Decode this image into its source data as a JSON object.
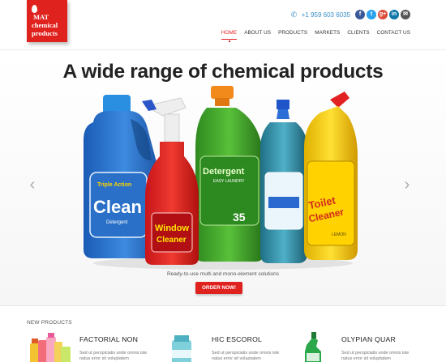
{
  "logo": {
    "line1": "MAT",
    "line2": "chemical",
    "line3": "products"
  },
  "header": {
    "phone": "+1 959 603 6035"
  },
  "nav": {
    "items": [
      {
        "label": "HOME"
      },
      {
        "label": "ABOUT US"
      },
      {
        "label": "PRODUCTS"
      },
      {
        "label": "MARKETS"
      },
      {
        "label": "CLIENTS"
      },
      {
        "label": "CONTACT US"
      }
    ]
  },
  "social": {
    "fb": "f",
    "tw": "t",
    "gp": "g+",
    "in": "in",
    "mail": "✉"
  },
  "hero": {
    "title": "A wide range of chemical products",
    "caption": "Ready-to-use multi and mono-element solutions",
    "button": "ORDER NOW!",
    "bottle_labels": {
      "triple": "Triple Action",
      "clean": "Clean",
      "detergent": "Detergent",
      "window1": "Window",
      "window2": "Cleaner",
      "green": "Detergent",
      "green_sub": "EASY LAUNDRY",
      "green_num": "35",
      "toilet1": "Toilet",
      "toilet2": "Cleaner",
      "lemon": "LEMON"
    }
  },
  "products": {
    "section_title": "NEW PRODUCTS",
    "items": [
      {
        "name": "FACTORIAL NON",
        "desc": "Sed ut perspiciatis unde omnis iste natus error sit voluptatem"
      },
      {
        "name": "HIC ESCOROL",
        "desc": "Sed ut perspiciatis unde omnis iste natus error sit voluptatem"
      },
      {
        "name": "OLYPIAN QUAR",
        "desc": "Sed ut perspiciatis unde omnis iste natus error sit voluptatem"
      }
    ]
  },
  "colors": {
    "brand": "#e0221f",
    "phone": "#3a8fc7"
  }
}
